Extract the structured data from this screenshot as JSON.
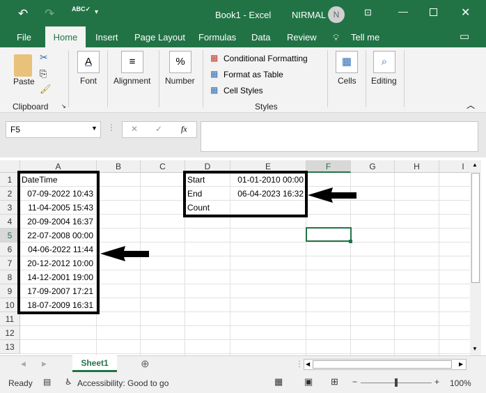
{
  "title": {
    "doc": "Book1  -  Excel",
    "user": "NIRMAL",
    "avatar": "N"
  },
  "tabs": [
    "File",
    "Home",
    "Insert",
    "Page Layout",
    "Formulas",
    "Data",
    "Review",
    "Tell me"
  ],
  "ribbon": {
    "paste": "Paste",
    "clipboard": "Clipboard",
    "font": "Font",
    "alignment": "Alignment",
    "number": "Number",
    "cond": "Conditional Formatting",
    "fmt_table": "Format as Table",
    "cell_styles": "Cell Styles",
    "styles": "Styles",
    "cells": "Cells",
    "editing": "Editing"
  },
  "formula": {
    "name_box": "F5",
    "fx": "fx",
    "value": ""
  },
  "columns": [
    "A",
    "B",
    "C",
    "D",
    "E",
    "F",
    "G",
    "H",
    "I"
  ],
  "rows": [
    "1",
    "2",
    "3",
    "4",
    "5",
    "6",
    "7",
    "8",
    "9",
    "10",
    "11",
    "12",
    "13"
  ],
  "col_a": [
    "DateTime",
    "07-09-2022 10:43",
    "11-04-2005 15:43",
    "20-09-2004 16:37",
    "22-07-2008 00:00",
    "04-06-2022 11:44",
    "20-12-2012 10:00",
    "14-12-2001 19:00",
    "17-09-2007 17:21",
    "18-07-2009 16:31"
  ],
  "col_d": [
    "Start",
    "End",
    "Count"
  ],
  "col_e": [
    "01-01-2010 00:00",
    "06-04-2023 16:32",
    ""
  ],
  "sheet": {
    "tab": "Sheet1"
  },
  "status": {
    "ready": "Ready",
    "accessibility": "Accessibility: Good to go",
    "zoom": "100%"
  }
}
